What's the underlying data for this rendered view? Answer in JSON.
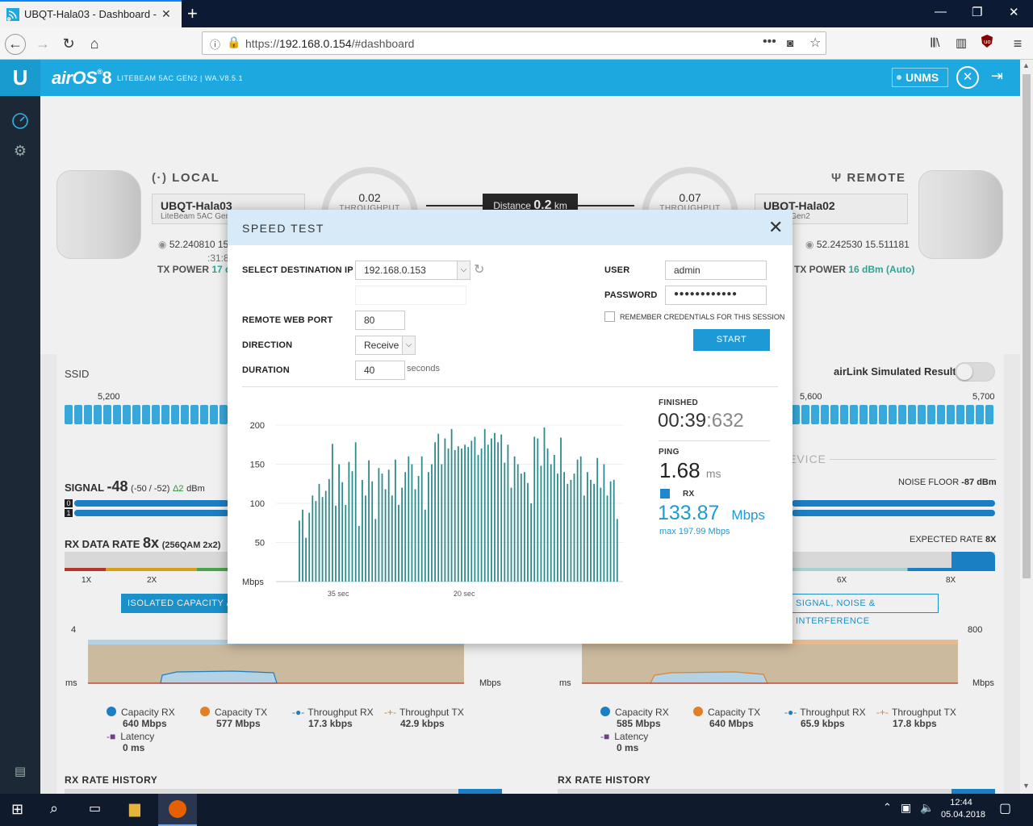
{
  "browser": {
    "tab_title": "UBQT-Hala03 - Dashboard - air",
    "url_prefix": "https://",
    "url_host": "192.168.0.154",
    "url_path": "/#dashboard"
  },
  "app": {
    "logo": "U",
    "brand": "airOS",
    "brand_version": "8",
    "model": "LITEBEAM 5AC GEN2 | WA.V8.5.1",
    "unms_label": "UNMS"
  },
  "dashboard": {
    "local": {
      "label": "LOCAL",
      "name": "UBQT-Hala03",
      "model": "LiteBeam 5AC Gen2",
      "coords": "52.240810  15",
      "time_fragment": ":31:8",
      "tx_power_label": "TX POWER",
      "tx_power_value": "17 d",
      "throughput": "0.02",
      "throughput_label": "THROUGHPUT"
    },
    "remote": {
      "label": "REMOTE",
      "name": "UBQT-Hala02",
      "model": "m 5AC Gen2",
      "coords": "52.242530  15.511181",
      "tx_power_label": "TX POWER",
      "tx_power_value": "16 dBm (Auto)",
      "throughput": "0.07",
      "throughput_label": "THROUGHPUT"
    },
    "distance_label": "Distance",
    "distance_value": "0.2",
    "distance_unit": "km",
    "ssid_label": "SSID",
    "freq_5200": "5,200",
    "freq_5600": "5,600",
    "freq_5700": "5,700",
    "airlink_label": "airLink Simulated Results",
    "signal_label": "SIGNAL",
    "signal_value": "-48",
    "signal_chains": "(-50 / -52)",
    "signal_delta": "Δ2",
    "signal_unit": "dBm",
    "chain0": "0",
    "chain1": "1",
    "evice_fragment": "EVICE",
    "noise_floor_label": "NOISE FLOOR",
    "noise_floor_value": "-87 dBm",
    "rx_rate_label": "RX DATA RATE",
    "rx_rate_value": "8x",
    "rx_rate_detail": "(256QAM 2x2)",
    "expected_rate_label": "EXPECTED RATE",
    "expected_rate_value": "8X",
    "scale_1x": "1X",
    "scale_2x": "2X",
    "scale_6x": "6X",
    "scale_8x": "8X",
    "isolated_btn": "ISOLATED CAPACITY / T",
    "signal_noise_btn": "SIGNAL, NOISE & INTERFERENCE",
    "left_chart": {
      "y_top": "4",
      "y_unit_left": "ms",
      "y_unit_right": "Mbps"
    },
    "right_chart": {
      "y_top": "800",
      "y_unit_left": "ms",
      "y_unit_right": "Mbps"
    },
    "legend_left": [
      {
        "name": "Capacity RX",
        "value": "640 Mbps",
        "color": "#1d87d0"
      },
      {
        "name": "Capacity TX",
        "value": "577 Mbps",
        "color": "#f0892b"
      },
      {
        "name": "Throughput RX",
        "value": "17.3 kbps",
        "color": "#1d87d0"
      },
      {
        "name": "Throughput TX",
        "value": "42.9 kbps",
        "color": "#f0892b"
      },
      {
        "name": "Latency",
        "value": "0 ms",
        "color": "#7b3f98"
      }
    ],
    "legend_right": [
      {
        "name": "Capacity RX",
        "value": "585 Mbps",
        "color": "#1d87d0"
      },
      {
        "name": "Capacity TX",
        "value": "640 Mbps",
        "color": "#f0892b"
      },
      {
        "name": "Throughput RX",
        "value": "65.9 kbps",
        "color": "#1d87d0"
      },
      {
        "name": "Throughput TX",
        "value": "17.8 kbps",
        "color": "#f0892b"
      },
      {
        "name": "Latency",
        "value": "0 ms",
        "color": "#7b3f98"
      }
    ],
    "rx_rate_history": "RX RATE HISTORY"
  },
  "speedtest": {
    "title": "SPEED TEST",
    "dest_ip_label": "SELECT DESTINATION IP",
    "dest_ip_value": "192.168.0.153",
    "web_port_label": "REMOTE WEB PORT",
    "web_port_value": "80",
    "direction_label": "DIRECTION",
    "direction_value": "Receive",
    "duration_label": "DURATION",
    "duration_value": "40",
    "duration_unit": "seconds",
    "user_label": "USER",
    "user_value": "admin",
    "password_label": "PASSWORD",
    "password_value": "●●●●●●●●●●●●",
    "remember_label": "REMEMBER CREDENTIALS FOR THIS SESSION",
    "start_label": "START",
    "finished_label": "FINISHED",
    "finished_time_main": "00:39",
    "finished_time_ms": ":632",
    "ping_label": "PING",
    "ping_value": "1.68",
    "ping_unit": "ms",
    "rx_label": "RX",
    "rx_value": "133.87",
    "rx_unit": "Mbps",
    "rx_max": "max 197.99 Mbps"
  },
  "chart_data": {
    "type": "bar",
    "ylabel": "Mbps",
    "ylim": [
      0,
      200
    ],
    "yticks": [
      200,
      150,
      100,
      50
    ],
    "xtick_labels": [
      "35 sec",
      "20 sec"
    ],
    "xtick_bar_index": [
      12,
      50
    ],
    "color": "#2e8b8b",
    "values": [
      78,
      92,
      56,
      88,
      110,
      103,
      125,
      108,
      116,
      131,
      176,
      97,
      150,
      127,
      98,
      153,
      141,
      178,
      71,
      130,
      110,
      155,
      128,
      80,
      145,
      138,
      118,
      143,
      110,
      156,
      98,
      120,
      140,
      160,
      150,
      118,
      135,
      160,
      92,
      140,
      150,
      178,
      189,
      150,
      183,
      170,
      195,
      168,
      173,
      170,
      175,
      172,
      180,
      185,
      162,
      170,
      195,
      175,
      183,
      190,
      178,
      188,
      152,
      175,
      120,
      160,
      150,
      138,
      140,
      126,
      100,
      185,
      183,
      148,
      197,
      170,
      150,
      162,
      138,
      184,
      140,
      125,
      130,
      138,
      156,
      160,
      110,
      140,
      130,
      125,
      158,
      120,
      150,
      110,
      128,
      130,
      80
    ]
  },
  "taskbar": {
    "time": "12:44",
    "date": "05.04.2018"
  }
}
